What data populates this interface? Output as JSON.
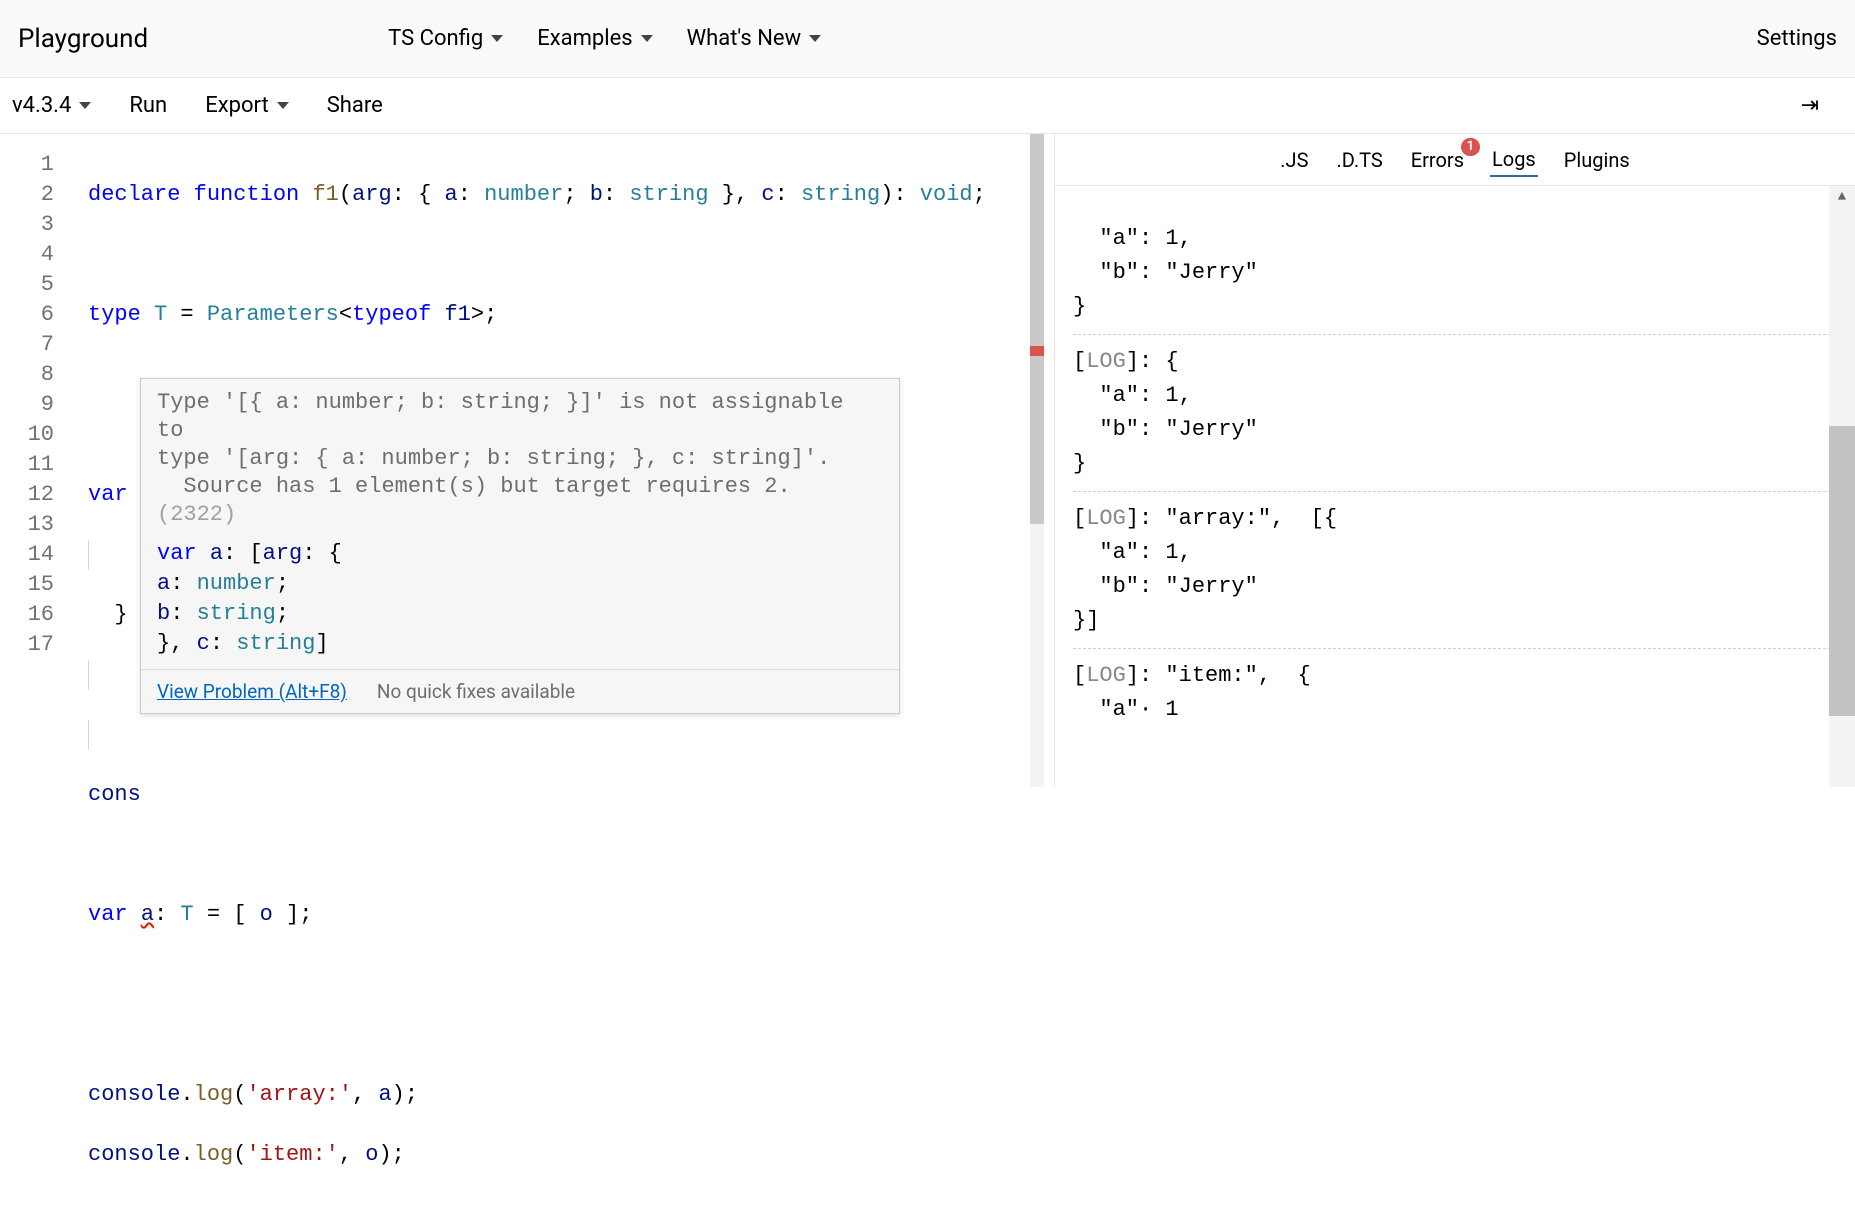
{
  "topbar": {
    "title": "Playground",
    "menus": [
      "TS Config",
      "Examples",
      "What's New"
    ],
    "settings": "Settings"
  },
  "subbar": {
    "version": "v4.3.4",
    "run": "Run",
    "export": "Export",
    "share": "Share"
  },
  "editor": {
    "line_count": 17,
    "lines": {
      "l1_declare": "declare",
      "l1_function": "function",
      "l1_f1": "f1",
      "l1_arg": "arg",
      "l1_a": "a",
      "l1_number": "number",
      "l1_b": "b",
      "l1_string": "string",
      "l1_c": "c",
      "l1_string2": "string",
      "l1_void": "void",
      "l3_type": "type",
      "l3_T": "T",
      "l3_Parameters": "Parameters",
      "l3_typeof": "typeof",
      "l3_f1": "f1",
      "l6_var": "var",
      "l11_cons": "cons",
      "l13_var": "var",
      "l13_a": "a",
      "l13_T": "T",
      "l13_o": "o",
      "l16_console": "console",
      "l16_log": "log",
      "l16_str": "'array:'",
      "l16_a": "a",
      "l17_console": "console",
      "l17_log": "log",
      "l17_str": "'item:'",
      "l17_o": "o"
    }
  },
  "hover": {
    "msg_l1": "Type '[{ a: number; b: string; }]' is not assignable to",
    "msg_l2": "type '[arg: { a: number; b: string; }, c: string]'.",
    "msg_l3a": "  Source has 1 element(s) but target requires 2. ",
    "msg_l3b": "(2322)",
    "sig_var": "var",
    "sig_a": "a",
    "sig_arg": "arg",
    "sig_aProp": "a",
    "sig_number": "number",
    "sig_bProp": "b",
    "sig_string": "string",
    "sig_c": "c",
    "sig_string2": "string",
    "footer_link": "View Problem (Alt+F8)",
    "footer_fix": "No quick fixes available"
  },
  "side": {
    "tabs": {
      "js": ".JS",
      "dts": ".D.TS",
      "errors": "Errors",
      "errors_badge": "1",
      "logs": "Logs",
      "plugins": "Plugins",
      "active": "logs"
    },
    "logs": [
      {
        "partial_top": true,
        "lines": [
          "  \"a\": 1,",
          "  \"b\": \"Jerry\"",
          "}"
        ]
      },
      {
        "label": "[LOG]:",
        "after": " {",
        "lines": [
          "  \"a\": 1,",
          "  \"b\": \"Jerry\"",
          "}"
        ]
      },
      {
        "label": "[LOG]:",
        "after": " \"array:\",  [{",
        "lines": [
          "  \"a\": 1,",
          "  \"b\": \"Jerry\"",
          "}]"
        ]
      },
      {
        "label": "[LOG]:",
        "after": " \"item:\",  {",
        "lines": [
          "  \"a\"· 1"
        ]
      }
    ]
  }
}
